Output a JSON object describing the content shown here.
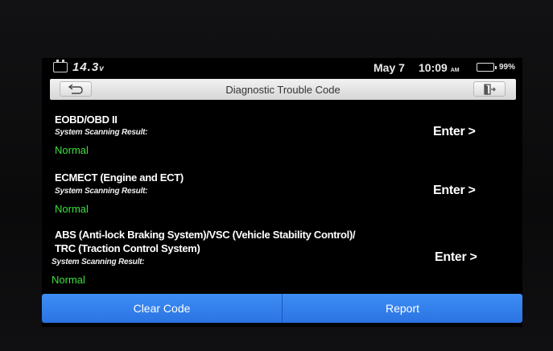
{
  "status": {
    "voltage": "14.3",
    "voltage_unit": "v",
    "date": "May 7",
    "time": "10:09",
    "ampm": "AM",
    "battery_pct": "99%",
    "battery_level": 0.99
  },
  "header": {
    "title": "Diagnostic Trouble Code",
    "back_icon": "back-arrow-icon",
    "exit_icon": "exit-door-icon"
  },
  "systems": [
    {
      "name": "EOBD/OBD II",
      "subtitle": "System Scanning Result:",
      "status": "Normal",
      "action": "Enter >"
    },
    {
      "name": "ECMECT (Engine and ECT)",
      "subtitle": "System Scanning Result:",
      "status": "Normal",
      "action": "Enter >"
    },
    {
      "name_line1": "ABS (Anti-lock Braking System)/VSC (Vehicle Stability Control)/",
      "name_line2": "TRC (Traction Control System)",
      "subtitle": "System Scanning Result:",
      "status": "Normal",
      "action": "Enter >"
    }
  ],
  "footer": {
    "clear_label": "Clear Code",
    "report_label": "Report"
  },
  "colors": {
    "accent": "#3d8ef5",
    "status_normal": "#3de03d",
    "battery": "#2ed43b"
  }
}
